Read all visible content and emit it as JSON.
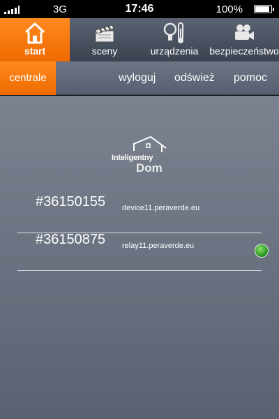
{
  "status_bar": {
    "carrier": "3G",
    "time": "17:46",
    "battery": "100%",
    "signal_icon": "signal-bars-icon",
    "battery_icon": "battery-charging-icon"
  },
  "top_nav": [
    {
      "label": "start",
      "icon": "home-icon",
      "active": true
    },
    {
      "label": "sceny",
      "icon": "clapperboard-icon",
      "active": false
    },
    {
      "label": "urządzenia",
      "icon": "bulb-thermometer-icon",
      "active": false
    },
    {
      "label": "bezpieczeństwo",
      "icon": "camera-icon",
      "active": false
    }
  ],
  "sub_nav": {
    "active_tab": "centrale",
    "links": [
      "wyloguj",
      "odśwież",
      "pomoc"
    ]
  },
  "logo": {
    "line1": "Inteligentny",
    "line2": "Dom"
  },
  "centrals": [
    {
      "id": "#36150155",
      "host": "device11.peraverde.eu"
    },
    {
      "id": "#36150875",
      "host": "relay11.peraverde.eu"
    }
  ],
  "colors": {
    "accent": "#f57a10",
    "status_online": "#2aa52a"
  }
}
